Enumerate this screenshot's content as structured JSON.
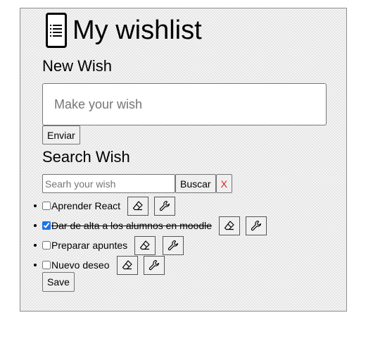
{
  "header": {
    "title": "My wishlist",
    "logo_icon": "list-icon"
  },
  "new_wish": {
    "heading": "New Wish",
    "placeholder": "Make your wish",
    "value": "",
    "submit_label": "Enviar"
  },
  "search": {
    "heading": "Search Wish",
    "placeholder": "Searh your wish",
    "value": "",
    "search_label": "Buscar",
    "clear_label": "X",
    "clear_color": "#e02020"
  },
  "wishes": [
    {
      "text": "Aprender React",
      "done": false
    },
    {
      "text": "Dar de alta a los alumnos en moodle",
      "done": true
    },
    {
      "text": "Preparar apuntes",
      "done": false
    },
    {
      "text": "Nuevo deseo",
      "done": false
    }
  ],
  "item_icons": {
    "delete": "eraser-icon",
    "edit": "wrench-icon"
  },
  "save_label": "Save"
}
